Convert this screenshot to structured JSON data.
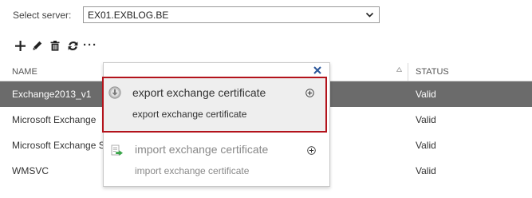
{
  "server": {
    "label": "Select server:",
    "selected": "EX01.EXBLOG.BE"
  },
  "toolbar": {
    "add_icon": "plus-icon",
    "edit_icon": "pencil-icon",
    "delete_icon": "trash-icon",
    "refresh_icon": "refresh-icon",
    "more_label": "···"
  },
  "table": {
    "columns": [
      "NAME",
      "STATUS"
    ],
    "rows": [
      {
        "name": "Exchange2013_v1",
        "status": "Valid"
      },
      {
        "name": "Microsoft Exchange",
        "status": "Valid"
      },
      {
        "name": "Microsoft Exchange S",
        "status": "Valid"
      },
      {
        "name": "WMSVC",
        "status": "Valid"
      }
    ]
  },
  "popup": {
    "close_icon": "close-icon",
    "items": [
      {
        "title": "export exchange certificate",
        "description": "export exchange certificate",
        "icon": "export-certificate-icon"
      },
      {
        "title": "import exchange certificate",
        "description": "import exchange certificate",
        "icon": "import-certificate-icon"
      }
    ]
  },
  "colors": {
    "selected_row": "#6b6b6b",
    "highlight_border": "#b3131b",
    "close_icon": "#2b579a"
  }
}
